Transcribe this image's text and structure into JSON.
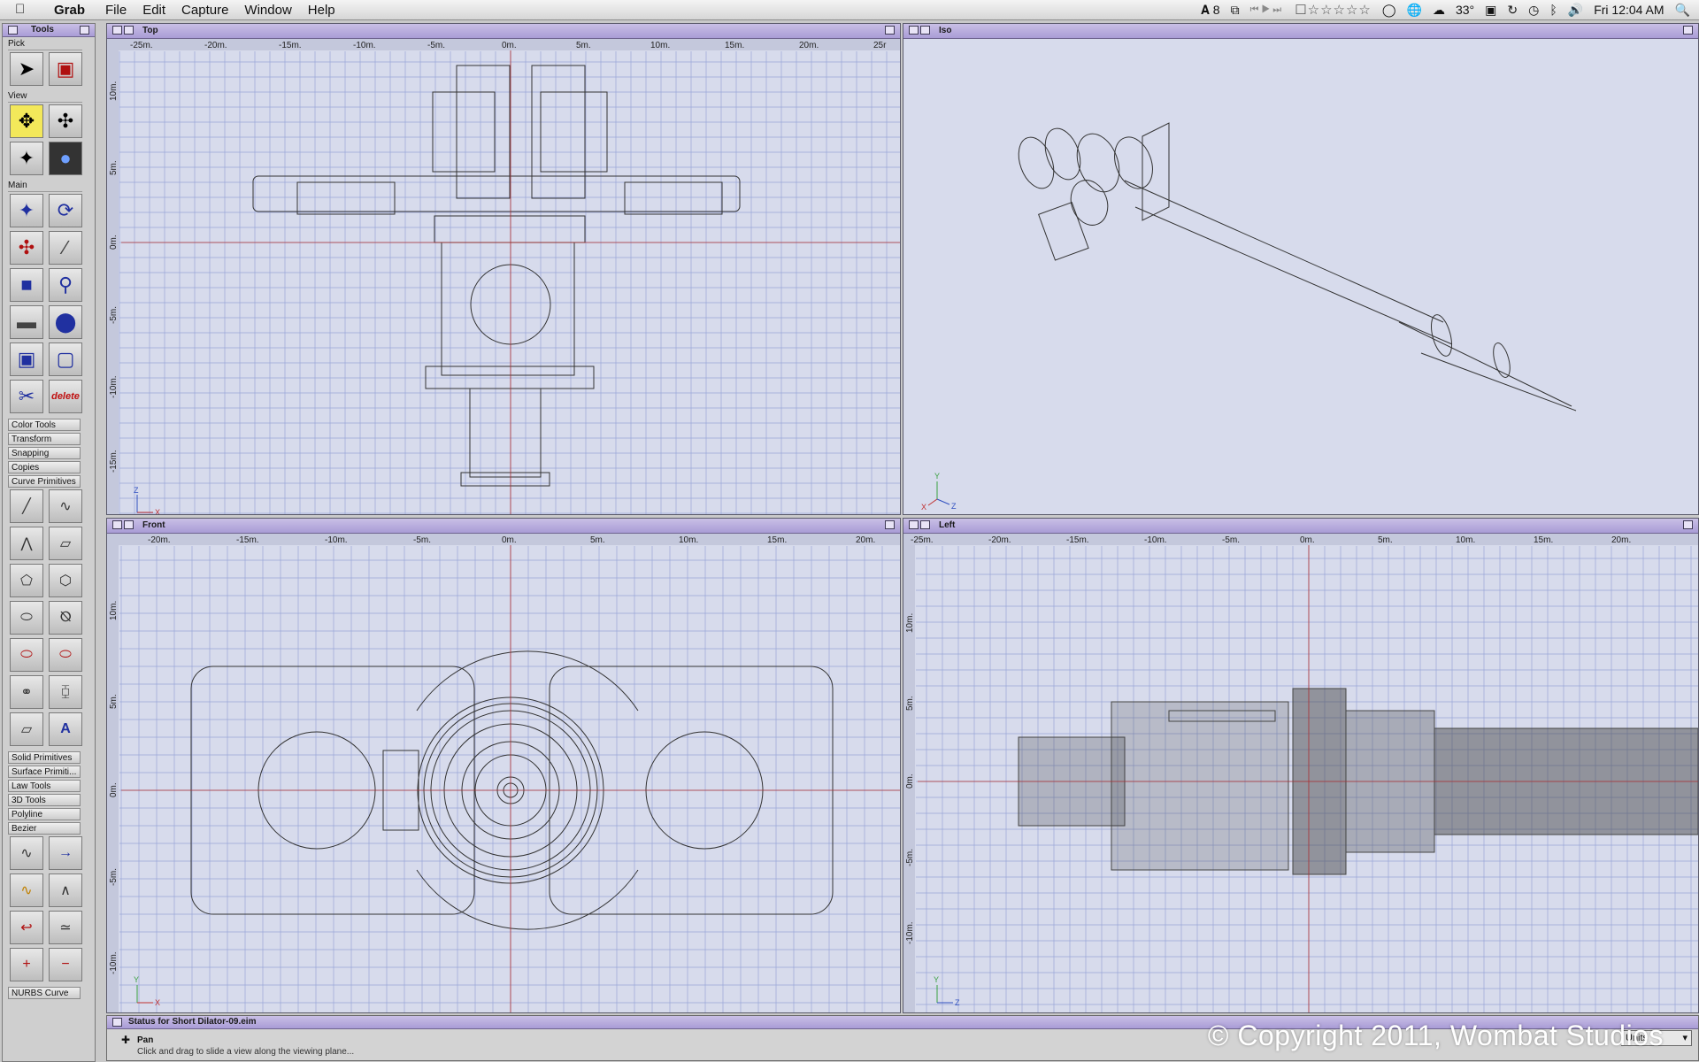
{
  "menubar": {
    "app_name": "Grab",
    "menus": [
      "File",
      "Edit",
      "Capture",
      "Window",
      "Help"
    ],
    "adobe_count": "8",
    "temperature": "33°",
    "clock": "Fri 12:04 AM"
  },
  "tools_palette": {
    "title": "Tools",
    "sections": {
      "pick": "Pick",
      "view": "View",
      "main": "Main"
    },
    "delete_label": "delete",
    "categories": [
      "Color Tools",
      "Transform",
      "Snapping",
      "Copies",
      "Curve Primitives"
    ],
    "categories2": [
      "Solid Primitives",
      "Surface Primiti...",
      "Law Tools",
      "3D Tools",
      "Polyline",
      "Bezier"
    ],
    "bottom_category": "NURBS Curve"
  },
  "viewports": {
    "top": {
      "title": "Top",
      "ruler_x": [
        "-25m.",
        "-20m.",
        "-15m.",
        "-10m.",
        "-5m.",
        "0m.",
        "5m.",
        "10m.",
        "15m.",
        "20m.",
        "25r"
      ],
      "ruler_y": [
        "10m.",
        "5m.",
        "0m.",
        "-5m.",
        "-10m.",
        "-15m."
      ],
      "axis_a": "Z",
      "axis_b": "X"
    },
    "iso": {
      "title": "Iso",
      "axis_a": "Y",
      "axis_b": "X",
      "axis_c": "Z"
    },
    "front": {
      "title": "Front",
      "ruler_x": [
        "-20m.",
        "-15m.",
        "-10m.",
        "-5m.",
        "0m.",
        "5m.",
        "10m.",
        "15m.",
        "20m."
      ],
      "ruler_y": [
        "10m.",
        "5m.",
        "0m.",
        "-5m.",
        "-10m."
      ],
      "axis_a": "Y",
      "axis_b": "X"
    },
    "left": {
      "title": "Left",
      "ruler_x": [
        "-25m.",
        "-20m.",
        "-15m.",
        "-10m.",
        "-5m.",
        "0m.",
        "5m.",
        "10m.",
        "15m.",
        "20m."
      ],
      "ruler_y": [
        "10m.",
        "5m.",
        "0m.",
        "-5m.",
        "-10m."
      ],
      "axis_a": "Y",
      "axis_b": "Z"
    }
  },
  "status": {
    "title": "Status for Short Dilator-09.eim",
    "mode": "Pan",
    "hint": "Click and drag to slide a view along the viewing plane...",
    "units": "Units"
  },
  "copyright": "© Copyright 2011, Wombat Studios"
}
